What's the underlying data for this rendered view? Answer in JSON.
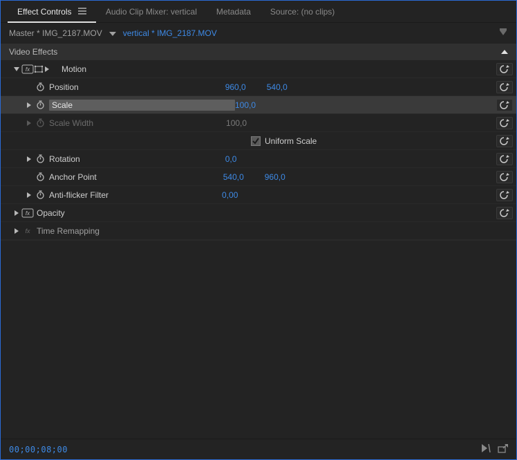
{
  "tabs": {
    "effect_controls": "Effect Controls",
    "audio_mixer": "Audio Clip Mixer: vertical",
    "metadata": "Metadata",
    "source": "Source: (no clips)"
  },
  "clip": {
    "master": "Master * IMG_2187.MOV",
    "sequence": "vertical * IMG_2187.MOV"
  },
  "section": {
    "video_effects": "Video Effects"
  },
  "motion": {
    "label": "Motion",
    "position": {
      "label": "Position",
      "x": "960,0",
      "y": "540,0"
    },
    "scale": {
      "label": "Scale",
      "value": "100,0"
    },
    "scale_width": {
      "label": "Scale Width",
      "value": "100,0"
    },
    "uniform_scale": {
      "label": "Uniform Scale"
    },
    "rotation": {
      "label": "Rotation",
      "value": "0,0"
    },
    "anchor": {
      "label": "Anchor Point",
      "x": "540,0",
      "y": "960,0"
    },
    "antiflicker": {
      "label": "Anti-flicker Filter",
      "value": "0,00"
    }
  },
  "opacity": {
    "label": "Opacity"
  },
  "time_remap": {
    "label": "Time Remapping"
  },
  "footer": {
    "timecode": "00;00;08;00"
  }
}
